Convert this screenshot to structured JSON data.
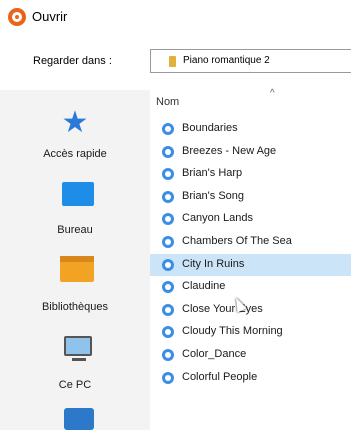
{
  "window": {
    "title": "Ouvrir",
    "icon": "app-circle-icon"
  },
  "lookin": {
    "label": "Regarder dans :",
    "value": "Piano romantique 2",
    "icon": "folder-icon"
  },
  "places": [
    {
      "label": "Accès rapide",
      "icon": "star-icon"
    },
    {
      "label": "Bureau",
      "icon": "desktop-icon"
    },
    {
      "label": "Bibliothèques",
      "icon": "libraries-icon"
    },
    {
      "label": "Ce PC",
      "icon": "computer-icon"
    },
    {
      "label": "",
      "icon": "network-icon"
    }
  ],
  "filelist": {
    "column_header": "Nom",
    "sort_glyph": "^",
    "selected_index": 6,
    "files": [
      "Boundaries",
      "Breezes - New Age",
      "Brian's Harp",
      "Brian's Song",
      "Canyon Lands",
      "Chambers Of The Sea",
      "City In Ruins",
      "Claudine",
      "Close Your Eyes",
      "Cloudy This Morning",
      "Color_Dance",
      "Colorful People"
    ]
  },
  "colors": {
    "accent": "#1d8de8",
    "selection": "#cce4f7",
    "app_icon": "#e8641b",
    "folder": "#e2b03c"
  }
}
